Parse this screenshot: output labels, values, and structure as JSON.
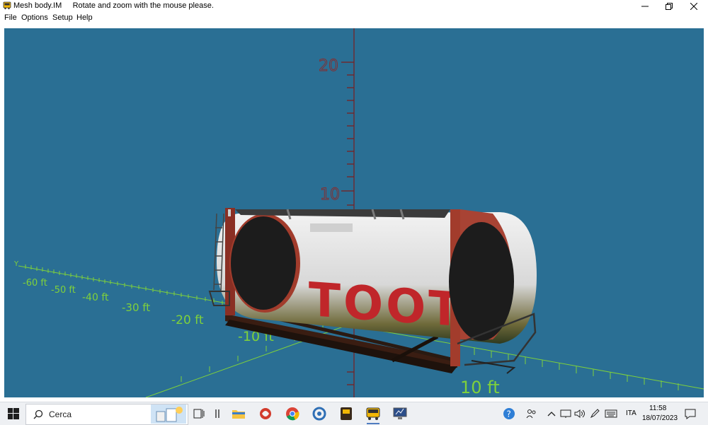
{
  "window": {
    "title": "Mesh body.IM",
    "message": "Rotate and zoom with the mouse please."
  },
  "menu": {
    "items": [
      "File",
      "Options",
      "Setup",
      "Help"
    ]
  },
  "viewport": {
    "background": "#2a6f94",
    "vertical_axis_labels": [
      "20",
      "10"
    ],
    "y_axis_letter": "Y",
    "depth_axis_labels": [
      "-60 ft",
      "-50 ft",
      "-40 ft",
      "-30 ft",
      "-20 ft",
      "-10 ft"
    ],
    "horizontal_axis_label": "10 ft",
    "object": "tank container",
    "tank_lettering": "TOOT"
  },
  "taskbar": {
    "search_placeholder": "Cerca",
    "language": "ITA",
    "time": "11:58",
    "date": "18/07/2023",
    "apps": [
      "task-view",
      "file-explorer",
      "app-red",
      "chrome",
      "app-blue-circle",
      "app-bus-dark",
      "app-bus-active",
      "app-monitor"
    ],
    "tray_icons": [
      "help",
      "people",
      "chevron-up",
      "network",
      "volume",
      "pen",
      "keyboard"
    ]
  }
}
